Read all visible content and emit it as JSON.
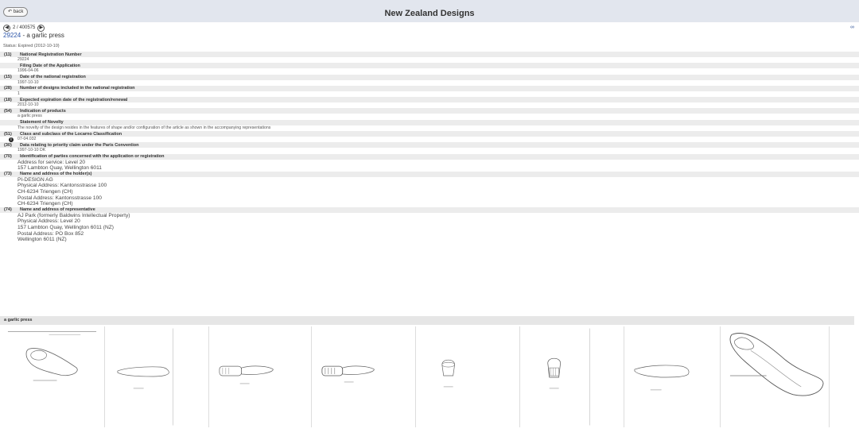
{
  "header": {
    "back_label": "back",
    "title": "New Zealand Designs"
  },
  "nav": {
    "prev_icon": "chevron-left-icon",
    "position": "2 / 400575",
    "next_icon": "chevron-right-icon",
    "link_icon": "chain-link-icon"
  },
  "record": {
    "number": "29224",
    "separator": " - ",
    "name": "a garlic press",
    "status": "Status: Expired (2012-10-10)"
  },
  "fields": [
    {
      "code": "(11)",
      "label": "National Registration Number",
      "values": [
        "29224"
      ]
    },
    {
      "code": "",
      "label": "Filing Date of the Application",
      "values": [
        "1996-04-06"
      ]
    },
    {
      "code": "(15)",
      "label": "Date of the national registration",
      "values": [
        "1997-10-10"
      ]
    },
    {
      "code": "(28)",
      "label": "Number of designs included in the national registration",
      "values": [
        "1"
      ]
    },
    {
      "code": "(18)",
      "label": "Expected expiration date of the registration/renewal",
      "values": [
        "2012-10-10"
      ]
    },
    {
      "code": "(54)",
      "label": "Indication of products",
      "values": [
        "a garlic press"
      ]
    },
    {
      "code": "",
      "label": "Statement of Novelty",
      "values": [
        "The novelty of the design resides in the features of shape and/or configuration of the article as shown in the accompanying representations"
      ]
    },
    {
      "code": "(51)",
      "label": "Class and subclass of the Locarno Classification",
      "values": [
        "07-04.032"
      ],
      "info": true
    },
    {
      "code": "(30)",
      "label": "Data relating to priority claim under the Paris Convention",
      "values": [
        "1997-10-10 DK"
      ]
    },
    {
      "code": "(70)",
      "label": "Identification of parties concerned with the application or registration",
      "values": [
        "Address for service: Level 20",
        "157 Lambton Quay, Wellington 6011"
      ],
      "big": true
    },
    {
      "code": "(73)",
      "label": "Name and address of the holder(s)",
      "values": [
        "PI-DESIGN AG",
        "Physical Address: Kantonsstrasse 100",
        "CH-6234 Triengen (CH)",
        "Postal Address: Kantonsstrasse 100",
        "CH-6234 Triengen (CH)"
      ],
      "big": true
    },
    {
      "code": "(74)",
      "label": "Name and address of representative",
      "values": [
        "AJ Park (formerly Baldwins Intellectual Property)",
        "Physical Address: Level 20",
        "157 Lambton Quay, Wellington 6011 (NZ)",
        "Postal Address: PO Box 852",
        "Wellington 6011 (NZ)"
      ],
      "big": true
    }
  ],
  "gallery": {
    "section_label": "a garlic press",
    "thumbnail_count": 8
  }
}
